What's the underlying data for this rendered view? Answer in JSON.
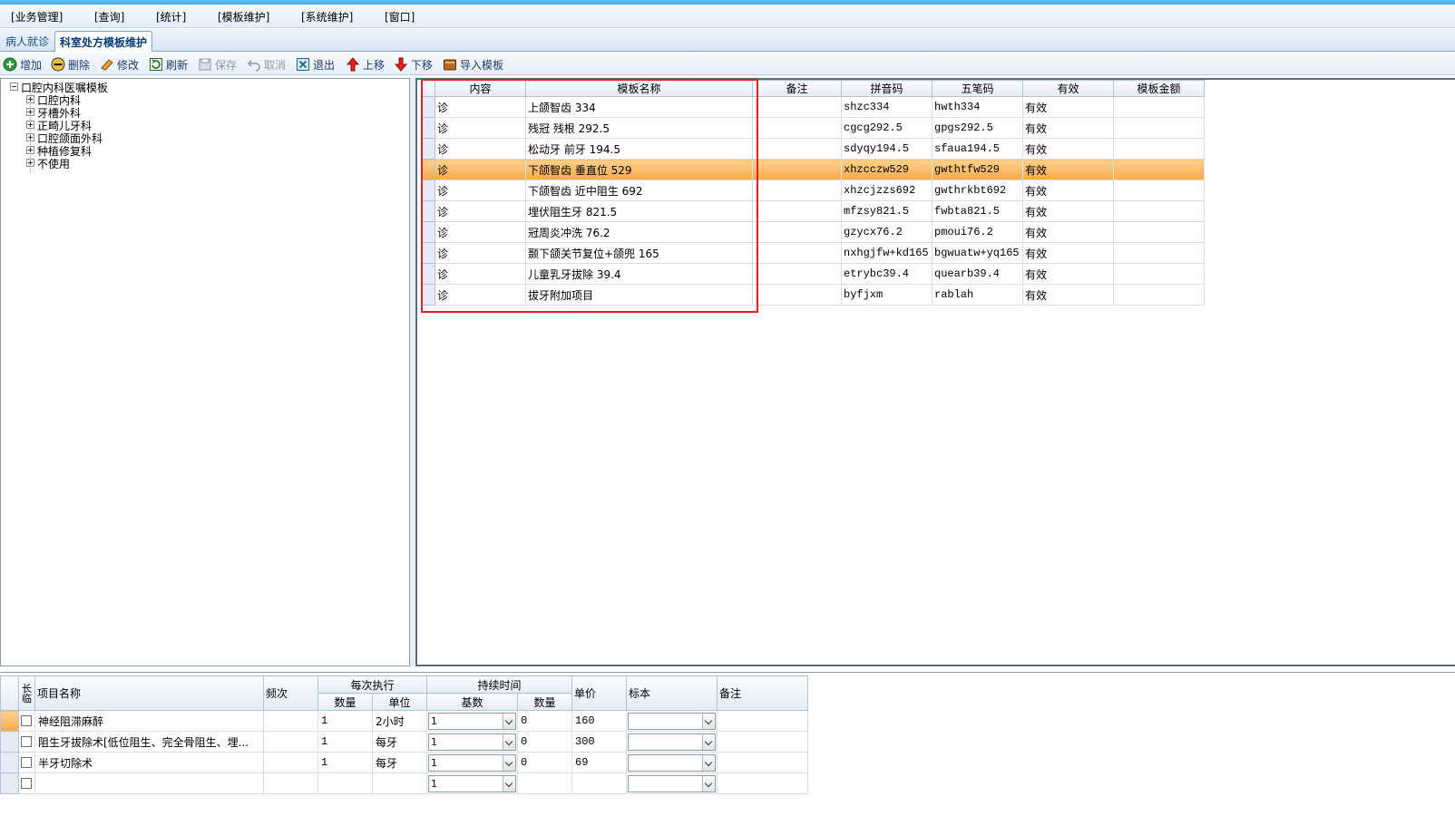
{
  "menu": [
    "[业务管理]",
    "[查询]",
    "[统计]",
    "[模板维护]",
    "[系统维护]",
    "[窗口]"
  ],
  "tabs": [
    {
      "label": "病人就诊",
      "active": false
    },
    {
      "label": "科室处方模板维护",
      "active": true
    }
  ],
  "toolbar": {
    "add": "增加",
    "delete": "删除",
    "edit": "修改",
    "refresh": "刷新",
    "save": "保存",
    "cancel": "取消",
    "exit": "退出",
    "move_up": "上移",
    "move_down": "下移",
    "import": "导入模板"
  },
  "tree": {
    "root": "口腔内科医嘱模板",
    "children": [
      "口腔内科",
      "牙槽外科",
      "正畸儿牙科",
      "口腔颌面外科",
      "种植修复科",
      "不使用"
    ]
  },
  "template_grid": {
    "columns": [
      "内容",
      "模板名称",
      "备注",
      "拼音码",
      "五笔码",
      "有效",
      "模板金额"
    ],
    "rows": [
      {
        "content": "诊",
        "name": "上颌智齿 334",
        "note": "",
        "pinyin": "shzc334",
        "wubi": "hwth334",
        "valid": "有效",
        "amount": ""
      },
      {
        "content": "诊",
        "name": "残冠 残根 292.5",
        "note": "",
        "pinyin": "cgcg292.5",
        "wubi": "gpgs292.5",
        "valid": "有效",
        "amount": ""
      },
      {
        "content": "诊",
        "name": "松动牙 前牙 194.5",
        "note": "",
        "pinyin": "sdyqy194.5",
        "wubi": "sfaua194.5",
        "valid": "有效",
        "amount": ""
      },
      {
        "content": "诊",
        "name": "下颌智齿 垂直位 529",
        "note": "",
        "pinyin": "xhzcczw529",
        "wubi": "gwthtfw529",
        "valid": "有效",
        "amount": ""
      },
      {
        "content": "诊",
        "name": "下颌智齿 近中阻生 692",
        "note": "",
        "pinyin": "xhzcjzzs692",
        "wubi": "gwthrkbt692",
        "valid": "有效",
        "amount": ""
      },
      {
        "content": "诊",
        "name": "埋伏阻生牙 821.5",
        "note": "",
        "pinyin": "mfzsy821.5",
        "wubi": "fwbta821.5",
        "valid": "有效",
        "amount": ""
      },
      {
        "content": "诊",
        "name": "冠周炎冲洗 76.2",
        "note": "",
        "pinyin": "gzycx76.2",
        "wubi": "pmoui76.2",
        "valid": "有效",
        "amount": ""
      },
      {
        "content": "诊",
        "name": "颞下颌关节复位+颌兜  165",
        "note": "",
        "pinyin": "nxhgjfw+kd165",
        "wubi": "bgwuatw+yq165",
        "valid": "有效",
        "amount": ""
      },
      {
        "content": "诊",
        "name": "儿童乳牙拔除 39.4",
        "note": "",
        "pinyin": "etrybc39.4",
        "wubi": "quearb39.4",
        "valid": "有效",
        "amount": ""
      },
      {
        "content": "诊",
        "name": "拔牙附加项目",
        "note": "",
        "pinyin": "byfjxm",
        "wubi": "rablah",
        "valid": "有效",
        "amount": ""
      }
    ],
    "selected_row": 3
  },
  "detail_grid": {
    "headers": {
      "long_temp": "长临",
      "item_name": "项目名称",
      "frequency": "频次",
      "per_exec": "每次执行",
      "qty": "数量",
      "unit": "单位",
      "duration": "持续时间",
      "base": "基数",
      "dur_qty": "数量",
      "price": "单价",
      "specimen": "标本",
      "note": "备注"
    },
    "rows": [
      {
        "name": "神经阻滞麻醉",
        "freq": "",
        "qty": "1",
        "unit": "2小时",
        "base": "1",
        "dur_qty": "0",
        "price": "160",
        "specimen": "",
        "note": ""
      },
      {
        "name": "阻生牙拔除术[低位阻生、完全骨阻生、埋...",
        "freq": "",
        "qty": "1",
        "unit": "每牙",
        "base": "1",
        "dur_qty": "0",
        "price": "300",
        "specimen": "",
        "note": ""
      },
      {
        "name": "半牙切除术",
        "freq": "",
        "qty": "1",
        "unit": "每牙",
        "base": "1",
        "dur_qty": "0",
        "price": "69",
        "specimen": "",
        "note": ""
      },
      {
        "name": "",
        "freq": "",
        "qty": "",
        "unit": "",
        "base": "1",
        "dur_qty": "",
        "price": "",
        "specimen": "",
        "note": ""
      }
    ]
  },
  "colors": {
    "selection": "#f7a94a",
    "highlight_box": "#e31e24",
    "accent": "#3ea6e6"
  }
}
